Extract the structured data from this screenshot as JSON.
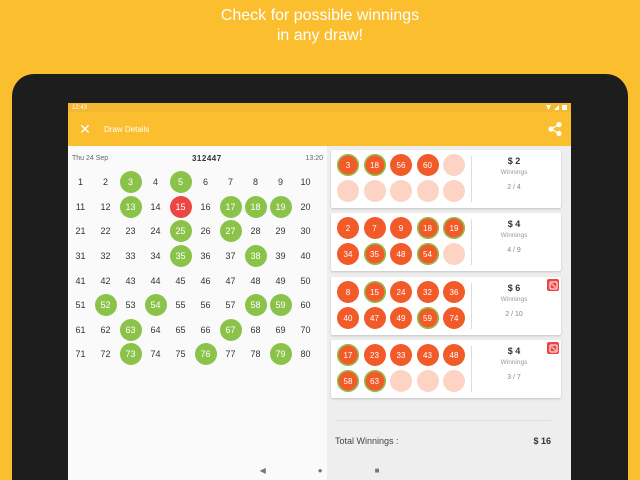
{
  "promo": {
    "line1": "Check for possible winnings",
    "line2": "in any draw!"
  },
  "statusbar": {
    "time": "12:43"
  },
  "appbar": {
    "title": "Draw Details",
    "close_icon": "close-icon",
    "share_icon": "share-icon"
  },
  "draw": {
    "date": "Thu 24 Sep",
    "number": "312447",
    "time": "13:20"
  },
  "board": {
    "numbers": [
      1,
      2,
      3,
      4,
      5,
      6,
      7,
      8,
      9,
      10,
      11,
      12,
      13,
      14,
      15,
      16,
      17,
      18,
      19,
      20,
      21,
      22,
      23,
      24,
      25,
      26,
      27,
      28,
      29,
      30,
      31,
      32,
      33,
      34,
      35,
      36,
      37,
      38,
      39,
      40,
      41,
      42,
      43,
      44,
      45,
      46,
      47,
      48,
      49,
      50,
      51,
      52,
      53,
      54,
      55,
      56,
      57,
      58,
      59,
      60,
      61,
      62,
      63,
      64,
      65,
      66,
      67,
      68,
      69,
      70,
      71,
      72,
      73,
      74,
      75,
      76,
      77,
      78,
      79,
      80
    ],
    "drawn": [
      3,
      5,
      13,
      15,
      17,
      18,
      19,
      25,
      27,
      35,
      38,
      52,
      54,
      58,
      59,
      63,
      67,
      73,
      76,
      79
    ],
    "bonus": [
      15
    ],
    "colors": {
      "drawn": "#8BC34A",
      "bonus": "#EF4444"
    }
  },
  "tickets": [
    {
      "numbers": [
        3,
        18,
        56,
        60
      ],
      "matched": [
        3,
        18
      ],
      "slots": 10,
      "prize": "$ 2",
      "winnings_label": "Winnings",
      "match": "2 / 4",
      "quick": false
    },
    {
      "numbers": [
        2,
        7,
        9,
        18,
        19,
        34,
        35,
        48,
        54
      ],
      "matched": [
        18,
        19,
        35,
        54
      ],
      "slots": 10,
      "prize": "$ 4",
      "winnings_label": "Winnings",
      "match": "4 / 9",
      "quick": false
    },
    {
      "numbers": [
        8,
        15,
        24,
        32,
        36,
        40,
        47,
        49,
        59,
        74
      ],
      "matched": [
        15,
        59
      ],
      "slots": 10,
      "prize": "$ 6",
      "winnings_label": "Winnings",
      "match": "2 / 10",
      "quick": true
    },
    {
      "numbers": [
        17,
        23,
        33,
        43,
        48,
        58,
        63
      ],
      "matched": [
        17,
        58,
        63
      ],
      "slots": 10,
      "prize": "$ 4",
      "winnings_label": "Winnings",
      "match": "3 / 7",
      "quick": true
    }
  ],
  "total": {
    "label": "Total Winnings :",
    "amount": "$ 16"
  },
  "navbar": {
    "back": "◀",
    "home": "●",
    "recents": "■"
  },
  "colors": {
    "accent": "#FBBE2E",
    "ball": "#F15A29",
    "empty_ball": "#FDD3C4"
  }
}
